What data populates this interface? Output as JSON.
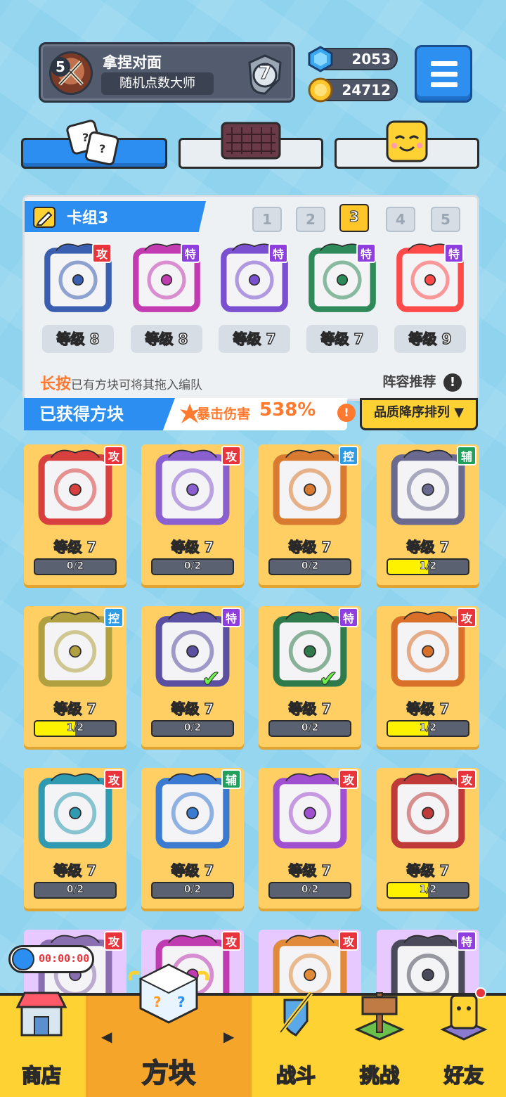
{
  "player": {
    "level": "5",
    "name": "拿捏对面",
    "title": "随机点数大师",
    "rank": "7"
  },
  "currency": {
    "gems": "2053",
    "coins": "24712"
  },
  "deck": {
    "title": "卡组3",
    "slots": [
      "1",
      "2",
      "3",
      "4",
      "5"
    ],
    "active_slot": "3",
    "cards": [
      {
        "tag": "攻",
        "tag_type": "atk",
        "level": "等级 8",
        "color": "#3b5fb0"
      },
      {
        "tag": "特",
        "tag_type": "spc",
        "level": "等级 8",
        "color": "#c23bb0"
      },
      {
        "tag": "特",
        "tag_type": "spc",
        "level": "等级 7",
        "color": "#7a4fd0"
      },
      {
        "tag": "特",
        "tag_type": "spc",
        "level": "等级 7",
        "color": "#2f8a5a"
      },
      {
        "tag": "特",
        "tag_type": "spc",
        "level": "等级 9",
        "color": "#ff4a4a"
      }
    ],
    "hint_highlight": "长按",
    "hint_rest": "已有方块可将其拖入编队",
    "recommend": "阵容推荐",
    "recommend_icon": "!"
  },
  "obtained": {
    "title": "已获得方块",
    "crit_label": "暴击伤害",
    "crit_value": "538%",
    "crit_icon": "!",
    "sort_label": "品质降序排列 ▼"
  },
  "grid": [
    {
      "tag": "攻",
      "tag_type": "atk",
      "level": "等级 7",
      "progress": "0/2",
      "fill": 0,
      "color": "#d84040",
      "checked": false
    },
    {
      "tag": "攻",
      "tag_type": "atk",
      "level": "等级 7",
      "progress": "0/2",
      "fill": 0,
      "color": "#8a5fd0",
      "checked": false
    },
    {
      "tag": "控",
      "tag_type": "ctl",
      "level": "等级 7",
      "progress": "0/2",
      "fill": 0,
      "color": "#d87a30",
      "checked": false
    },
    {
      "tag": "辅",
      "tag_type": "sup",
      "level": "等级 7",
      "progress": "1/2",
      "fill": 0.5,
      "color": "#6a6a90",
      "checked": false
    },
    {
      "tag": "控",
      "tag_type": "ctl",
      "level": "等级 7",
      "progress": "1/2",
      "fill": 0.5,
      "color": "#b0a040",
      "checked": false
    },
    {
      "tag": "特",
      "tag_type": "spc",
      "level": "等级 7",
      "progress": "0/2",
      "fill": 0,
      "color": "#5a4fa0",
      "checked": true
    },
    {
      "tag": "特",
      "tag_type": "spc",
      "level": "等级 7",
      "progress": "0/2",
      "fill": 0,
      "color": "#2f7a4a",
      "checked": true
    },
    {
      "tag": "攻",
      "tag_type": "atk",
      "level": "等级 7",
      "progress": "1/2",
      "fill": 0.5,
      "color": "#d8702a",
      "checked": false
    },
    {
      "tag": "攻",
      "tag_type": "atk",
      "level": "等级 7",
      "progress": "0/2",
      "fill": 0,
      "color": "#2f9ab0",
      "checked": false
    },
    {
      "tag": "辅",
      "tag_type": "sup",
      "level": "等级 7",
      "progress": "0/2",
      "fill": 0,
      "color": "#3a7ad0",
      "checked": false
    },
    {
      "tag": "攻",
      "tag_type": "atk",
      "level": "等级 7",
      "progress": "0/2",
      "fill": 0,
      "color": "#a04fd0",
      "checked": false
    },
    {
      "tag": "攻",
      "tag_type": "atk",
      "level": "等级 7",
      "progress": "1/2",
      "fill": 0.5,
      "color": "#c03a3a",
      "checked": false
    },
    {
      "tag": "攻",
      "tag_type": "atk",
      "level": "",
      "progress": "",
      "fill": 0,
      "color": "#8a6fb0",
      "checked": false,
      "purple": true
    },
    {
      "tag": "攻",
      "tag_type": "atk",
      "level": "",
      "progress": "",
      "fill": 0,
      "color": "#c03ab0",
      "checked": false,
      "purple": true
    },
    {
      "tag": "攻",
      "tag_type": "atk",
      "level": "",
      "progress": "",
      "fill": 0,
      "color": "#e08a3a",
      "checked": false,
      "purple": true
    },
    {
      "tag": "特",
      "tag_type": "spc",
      "level": "",
      "progress": "",
      "fill": 0,
      "color": "#4a4a5a",
      "checked": true,
      "purple": true
    }
  ],
  "timer": "00:00:00",
  "nav": {
    "shop": "商店",
    "blocks": "方块",
    "battle": "战斗",
    "challenge": "挑战",
    "friends": "好友"
  }
}
